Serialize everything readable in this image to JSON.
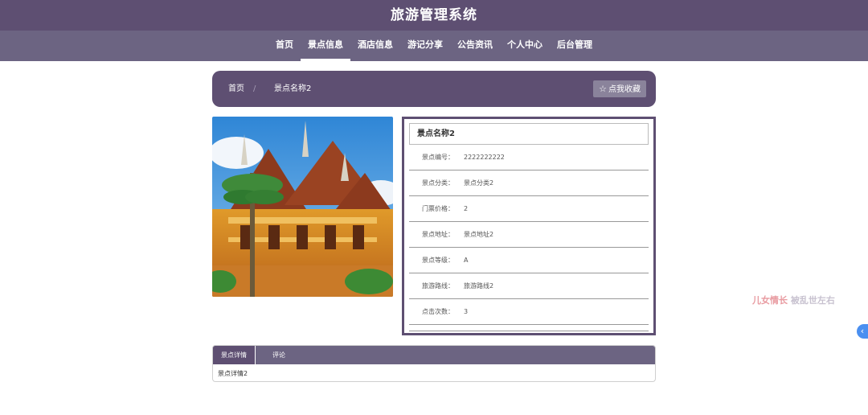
{
  "site": {
    "title": "旅游管理系统"
  },
  "nav": {
    "items": [
      {
        "label": "首页"
      },
      {
        "label": "景点信息"
      },
      {
        "label": "酒店信息"
      },
      {
        "label": "游记分享"
      },
      {
        "label": "公告资讯"
      },
      {
        "label": "个人中心"
      },
      {
        "label": "后台管理"
      }
    ],
    "active_index": 1
  },
  "breadcrumb": {
    "home": "首页",
    "separator": "/",
    "current": "景点名称2"
  },
  "favorite": {
    "icon": "star-outline-icon",
    "label": "点我收藏"
  },
  "photo": {
    "subject": "temple-photo"
  },
  "detail": {
    "title": "景点名称2",
    "rows": [
      {
        "label": "景点编号：",
        "value": "2222222222"
      },
      {
        "label": "景点分类：",
        "value": "景点分类2"
      },
      {
        "label": "门票价格：",
        "value": "2"
      },
      {
        "label": "景点地址：",
        "value": "景点地址2"
      },
      {
        "label": "景点等级：",
        "value": "A"
      },
      {
        "label": "旅游路线：",
        "value": "旅游路线2"
      },
      {
        "label": "点击次数：",
        "value": "3"
      }
    ]
  },
  "tabs": {
    "items": [
      {
        "label": "景点详情"
      },
      {
        "label": "评论"
      }
    ],
    "active_index": 0,
    "content": "景点详情2"
  },
  "watermark": {
    "part1": "儿女情长",
    "part2": " 被乱世左右"
  },
  "side_tab": {
    "icon": "chevron-left-icon",
    "glyph": "‹"
  },
  "colors": {
    "primary": "#5e4f72",
    "nav": "#6c6482",
    "accent": "#4a8ff0"
  }
}
